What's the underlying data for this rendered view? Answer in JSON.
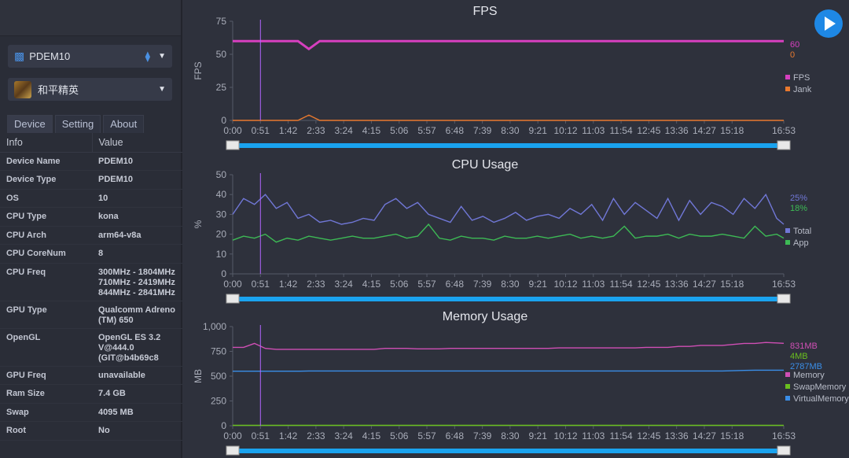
{
  "device_select": {
    "label": "PDEM10",
    "icon": "android-icon",
    "connection_icon": "usb-cable-icon"
  },
  "app_select": {
    "label": "和平精英",
    "icon": "game-app-icon"
  },
  "tabs": [
    "Device",
    "Setting",
    "About"
  ],
  "info_table": {
    "headers": [
      "Info",
      "Value"
    ],
    "rows": [
      [
        "Device Name",
        "PDEM10"
      ],
      [
        "Device Type",
        "PDEM10"
      ],
      [
        "OS",
        "10"
      ],
      [
        "CPU Type",
        "kona"
      ],
      [
        "CPU Arch",
        "arm64-v8a"
      ],
      [
        "CPU CoreNum",
        "8"
      ],
      [
        "CPU Freq",
        "300MHz - 1804MHz\n710MHz - 2419MHz\n844MHz - 2841MHz"
      ],
      [
        "GPU Type",
        "Qualcomm Adreno (TM) 650"
      ],
      [
        "OpenGL",
        "OpenGL ES 3.2 V@444.0 (GIT@b4b69c8"
      ],
      [
        "GPU Freq",
        "unavailable"
      ],
      [
        "Ram Size",
        "7.4 GB"
      ],
      [
        "Swap",
        "4095 MB"
      ],
      [
        "Root",
        "No"
      ]
    ]
  },
  "play_button": {
    "icon": "play-icon",
    "color": "#1e88e5"
  },
  "slider_color": "#1aa3ef",
  "cursor_time": "0:51",
  "chart_data": [
    {
      "type": "line",
      "title": "FPS",
      "ylabel": "FPS",
      "ylim": [
        0,
        75
      ],
      "yticks": [
        "0",
        "25",
        "50",
        "75"
      ],
      "ytick_values": [
        0,
        25,
        50,
        75
      ],
      "xticks": [
        "0:00",
        "0:51",
        "1:42",
        "2:33",
        "3:24",
        "4:15",
        "5:06",
        "5:57",
        "6:48",
        "7:39",
        "8:30",
        "9:21",
        "10:12",
        "11:03",
        "11:54",
        "12:45",
        "13:36",
        "14:27",
        "15:18",
        "16:53"
      ],
      "xlim_s": [
        0,
        1013
      ],
      "x": [
        0,
        20,
        40,
        60,
        80,
        100,
        120,
        140,
        160,
        180,
        200,
        220,
        240,
        260,
        280,
        300,
        320,
        340,
        360,
        380,
        400,
        420,
        440,
        460,
        480,
        500,
        520,
        540,
        560,
        580,
        600,
        620,
        640,
        660,
        680,
        700,
        720,
        740,
        760,
        780,
        800,
        820,
        840,
        860,
        880,
        900,
        920,
        940,
        960,
        980,
        1000,
        1013
      ],
      "series": [
        {
          "name": "FPS",
          "color": "#d63fbf",
          "current": "60",
          "values": [
            60,
            60,
            60,
            60,
            60,
            60,
            60,
            54,
            60,
            60,
            60,
            60,
            60,
            60,
            60,
            60,
            60,
            60,
            60,
            60,
            60,
            60,
            60,
            60,
            60,
            60,
            60,
            60,
            60,
            60,
            60,
            60,
            60,
            60,
            60,
            60,
            60,
            60,
            60,
            60,
            60,
            60,
            60,
            60,
            60,
            60,
            60,
            60,
            60,
            60,
            60,
            60
          ]
        },
        {
          "name": "Jank",
          "color": "#e8792e",
          "current": "0",
          "values": [
            0,
            0,
            0,
            0,
            0,
            0,
            0,
            4,
            0,
            0,
            0,
            0,
            0,
            0,
            0,
            0,
            0,
            0,
            0,
            0,
            0,
            0,
            0,
            0,
            0,
            0,
            0,
            0,
            0,
            0,
            0,
            0,
            0,
            0,
            0,
            0,
            0,
            0,
            0,
            0,
            0,
            0,
            0,
            0,
            0,
            0,
            0,
            0,
            0,
            0,
            0,
            0
          ]
        }
      ]
    },
    {
      "type": "line",
      "title": "CPU Usage",
      "ylabel": "%",
      "ylim": [
        0,
        50
      ],
      "yticks": [
        "0",
        "10",
        "20",
        "30",
        "40",
        "50"
      ],
      "ytick_values": [
        0,
        10,
        20,
        30,
        40,
        50
      ],
      "xticks": [
        "0:00",
        "0:51",
        "1:42",
        "2:33",
        "3:24",
        "4:15",
        "5:06",
        "5:57",
        "6:48",
        "7:39",
        "8:30",
        "9:21",
        "10:12",
        "11:03",
        "11:54",
        "12:45",
        "13:36",
        "14:27",
        "15:18",
        "16:53"
      ],
      "xlim_s": [
        0,
        1013
      ],
      "x": [
        0,
        20,
        40,
        60,
        80,
        100,
        120,
        140,
        160,
        180,
        200,
        220,
        240,
        260,
        280,
        300,
        320,
        340,
        360,
        380,
        400,
        420,
        440,
        460,
        480,
        500,
        520,
        540,
        560,
        580,
        600,
        620,
        640,
        660,
        680,
        700,
        720,
        740,
        760,
        780,
        800,
        820,
        840,
        860,
        880,
        900,
        920,
        940,
        960,
        980,
        1000,
        1013
      ],
      "series": [
        {
          "name": "Total",
          "color": "#7077d6",
          "current": "25%",
          "values": [
            30,
            38,
            35,
            40,
            33,
            36,
            28,
            30,
            26,
            27,
            25,
            26,
            28,
            27,
            35,
            38,
            33,
            36,
            30,
            28,
            26,
            34,
            27,
            29,
            26,
            28,
            31,
            27,
            29,
            30,
            28,
            33,
            30,
            35,
            27,
            38,
            30,
            36,
            32,
            28,
            38,
            27,
            37,
            30,
            36,
            34,
            30,
            38,
            33,
            40,
            28,
            25
          ]
        },
        {
          "name": "App",
          "color": "#3dba55",
          "current": "18%",
          "values": [
            17,
            19,
            18,
            20,
            16,
            18,
            17,
            19,
            18,
            17,
            18,
            19,
            18,
            18,
            19,
            20,
            18,
            19,
            25,
            18,
            17,
            19,
            18,
            18,
            17,
            19,
            18,
            18,
            19,
            18,
            19,
            20,
            18,
            19,
            18,
            19,
            24,
            18,
            19,
            19,
            20,
            18,
            20,
            19,
            19,
            20,
            19,
            18,
            24,
            19,
            20,
            18
          ]
        }
      ]
    },
    {
      "type": "line",
      "title": "Memory Usage",
      "ylabel": "MB",
      "ylim": [
        0,
        1000
      ],
      "yticks": [
        "0",
        "250",
        "500",
        "750",
        "1,000"
      ],
      "ytick_values": [
        0,
        250,
        500,
        750,
        1000
      ],
      "xticks": [
        "0:00",
        "0:51",
        "1:42",
        "2:33",
        "3:24",
        "4:15",
        "5:06",
        "5:57",
        "6:48",
        "7:39",
        "8:30",
        "9:21",
        "10:12",
        "11:03",
        "11:54",
        "12:45",
        "13:36",
        "14:27",
        "15:18",
        "16:53"
      ],
      "xlim_s": [
        0,
        1013
      ],
      "x": [
        0,
        20,
        40,
        60,
        80,
        100,
        120,
        140,
        160,
        180,
        200,
        220,
        240,
        260,
        280,
        300,
        320,
        340,
        360,
        380,
        400,
        420,
        440,
        460,
        480,
        500,
        520,
        540,
        560,
        580,
        600,
        620,
        640,
        660,
        680,
        700,
        720,
        740,
        760,
        780,
        800,
        820,
        840,
        860,
        880,
        900,
        920,
        940,
        960,
        980,
        1000,
        1013
      ],
      "series": [
        {
          "name": "Memory",
          "color": "#d04fb5",
          "current": "831MB",
          "values": [
            790,
            790,
            830,
            780,
            770,
            770,
            770,
            770,
            770,
            770,
            770,
            770,
            770,
            770,
            780,
            780,
            780,
            775,
            775,
            775,
            780,
            780,
            780,
            780,
            780,
            780,
            780,
            780,
            780,
            780,
            785,
            785,
            785,
            785,
            785,
            785,
            785,
            785,
            790,
            790,
            790,
            800,
            800,
            810,
            810,
            810,
            820,
            830,
            830,
            840,
            835,
            831
          ]
        },
        {
          "name": "SwapMemory",
          "color": "#6abf1f",
          "current": "4MB",
          "values": [
            4,
            4,
            4,
            4,
            4,
            4,
            4,
            4,
            4,
            4,
            4,
            4,
            4,
            4,
            4,
            4,
            4,
            4,
            4,
            4,
            4,
            4,
            4,
            4,
            4,
            4,
            4,
            4,
            4,
            4,
            4,
            4,
            4,
            4,
            4,
            4,
            4,
            4,
            4,
            4,
            4,
            4,
            4,
            4,
            4,
            4,
            4,
            4,
            4,
            4,
            4,
            4
          ]
        },
        {
          "name": "VirtualMemory",
          "color": "#3a8ee8",
          "current": "2787MB",
          "values": [
            550,
            550,
            550,
            550,
            550,
            550,
            550,
            552,
            552,
            552,
            552,
            552,
            552,
            552,
            552,
            552,
            552,
            552,
            552,
            552,
            552,
            552,
            552,
            552,
            552,
            552,
            552,
            552,
            552,
            552,
            552,
            552,
            552,
            552,
            552,
            552,
            552,
            552,
            552,
            552,
            552,
            552,
            552,
            552,
            552,
            552,
            555,
            558,
            560,
            560,
            560,
            560
          ]
        }
      ]
    }
  ]
}
